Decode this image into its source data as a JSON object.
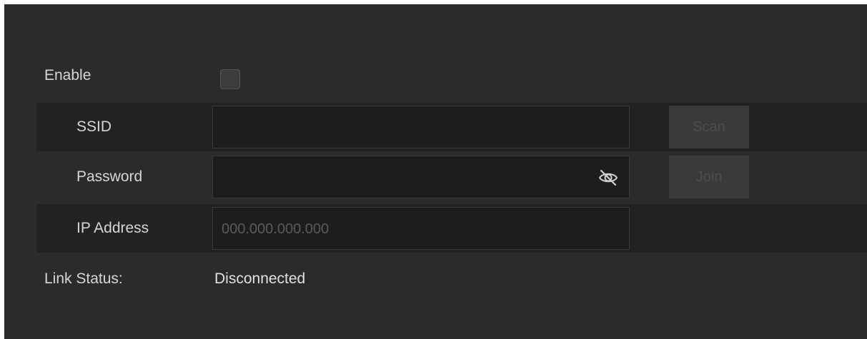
{
  "form": {
    "enable_label": "Enable",
    "enable_checked": false,
    "ssid_label": "SSID",
    "ssid_value": "",
    "scan_label": "Scan",
    "password_label": "Password",
    "password_value": "",
    "password_visibility_icon": "eye-off-icon",
    "join_label": "Join",
    "ip_label": "IP Address",
    "ip_placeholder": "000.000.000.000",
    "link_status_label": "Link Status:",
    "link_status_value": "Disconnected"
  },
  "colors": {
    "panel_bg": "#2b2b2b",
    "row_dark_bg": "#222222",
    "field_bg": "#1d1d1d",
    "button_disabled_bg": "#3a3a3a",
    "text": "#d6d6d6"
  }
}
